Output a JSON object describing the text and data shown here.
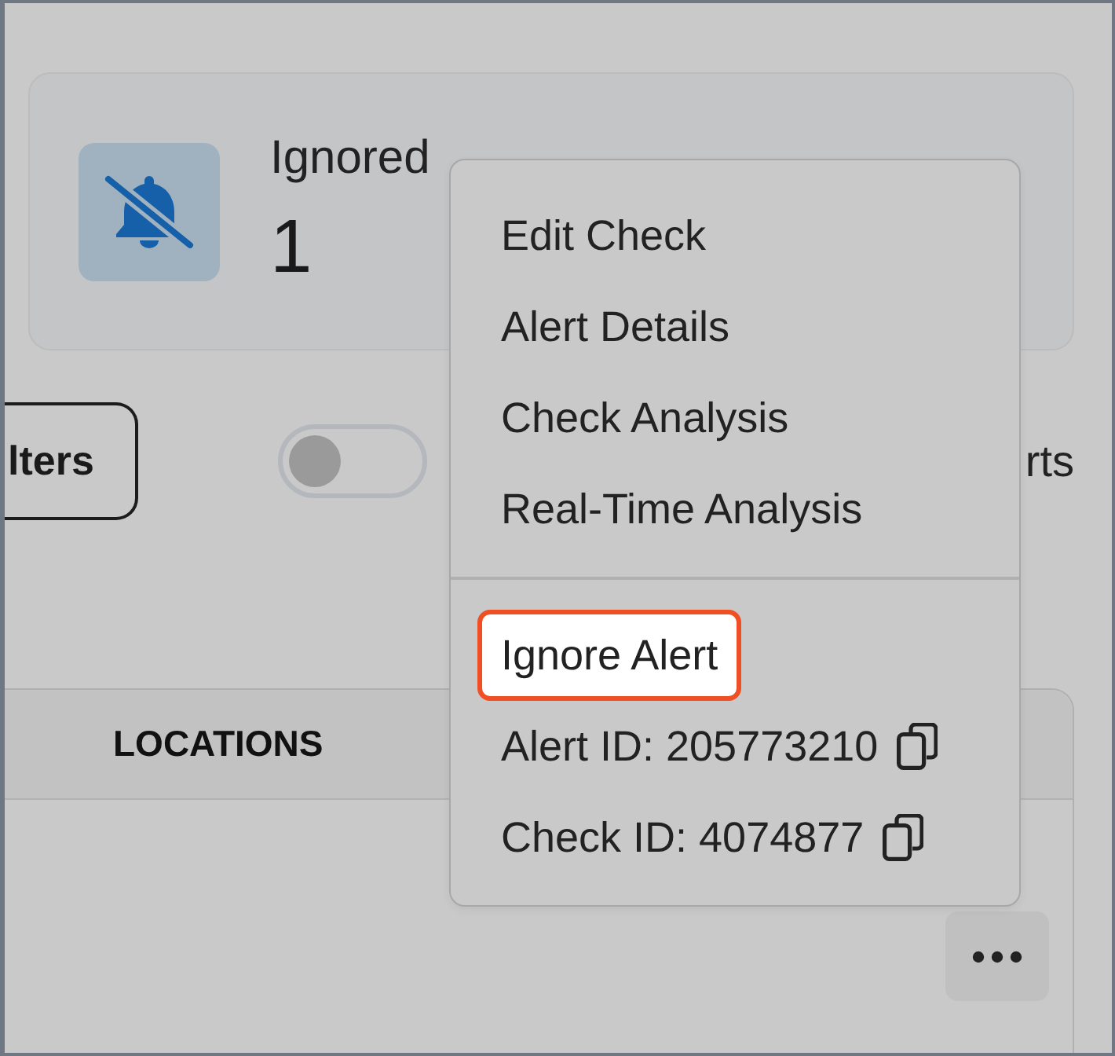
{
  "stat_card": {
    "title": "Ignored",
    "value": "1"
  },
  "toolbar": {
    "filters_button": "lters",
    "toggle": {
      "on": false
    },
    "label": "rts"
  },
  "table": {
    "columns": [
      "LOCATIONS"
    ]
  },
  "context_menu": {
    "sections": [
      {
        "items": [
          {
            "kind": "action",
            "label": "Edit Check",
            "highlighted": false
          },
          {
            "kind": "action",
            "label": "Alert Details",
            "highlighted": false
          },
          {
            "kind": "action",
            "label": "Check Analysis",
            "highlighted": false
          },
          {
            "kind": "action",
            "label": "Real-Time Analysis",
            "highlighted": false
          }
        ]
      },
      {
        "items": [
          {
            "kind": "action",
            "label": "Ignore Alert",
            "highlighted": true
          },
          {
            "kind": "copy",
            "label": "Alert ID: 205773210",
            "highlighted": false
          },
          {
            "kind": "copy",
            "label": "Check ID: 4074877",
            "highlighted": false
          }
        ]
      }
    ]
  }
}
